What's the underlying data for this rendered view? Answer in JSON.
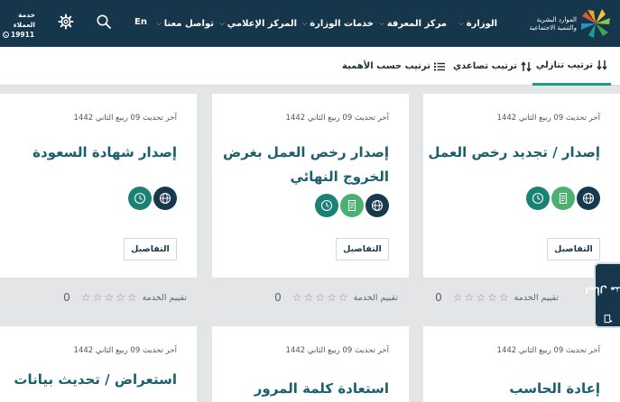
{
  "header": {
    "logo_text": [
      "الموارد البشرية",
      "والتنمية الاجتماعية"
    ],
    "nav": [
      {
        "label": "الوزارة",
        "has_menu": true
      },
      {
        "label": "مركز المعرفة",
        "has_menu": true
      },
      {
        "label": "خدمات الوزارة",
        "has_menu": true
      },
      {
        "label": "المركز الإعلامي",
        "has_menu": true
      },
      {
        "label": "تواصل معنا",
        "has_menu": true
      }
    ],
    "language": "En",
    "customer_care": {
      "line1": "خدمة",
      "line2": "العملاء",
      "phone": "19911"
    },
    "colors": {
      "header_bg": "#16364c",
      "accent": "#1b9d8a"
    }
  },
  "sort_options": [
    {
      "label": "ترتيب تنازلي",
      "icon": "sort-descending-icon",
      "active": true
    },
    {
      "label": "ترتيب تصاعدي",
      "icon": "sort-ascending-icon",
      "active": false
    },
    {
      "label": "ترتيب حسب الأهمية",
      "icon": "list-icon",
      "active": false
    }
  ],
  "cards": [
    {
      "date": "آخر تحديث 09 ربيع الثاني 1442",
      "title": [
        "إصدار / تجديد رخص العمل"
      ],
      "icons": [
        "globe-icon",
        "document-icon",
        "clock-icon"
      ],
      "details": "التفاصيل"
    },
    {
      "date": "آخر تحديث 09 ربيع الثاني 1442",
      "title": [
        "إصدار رخص العمل بغرض",
        "الخروج النهائي"
      ],
      "icons": [
        "globe-icon",
        "document-icon",
        "clock-icon"
      ],
      "details": "التفاصيل"
    },
    {
      "date": "آخر تحديث 09 ربيع الثاني 1442",
      "title": [
        "إصدار شهادة السعودة"
      ],
      "icons": [
        "globe-icon",
        "clock-icon"
      ],
      "details": "التفاصيل"
    },
    {
      "date": "آخر تحديث 09 ربيع الثاني 1442",
      "title": [
        "إعادة الحاسب"
      ]
    },
    {
      "date": "آخر تحديث 09 ربيع الثاني 1442",
      "title": [
        "استعادة كلمة المرور"
      ]
    },
    {
      "date": "آخر تحديث 09 ربيع الثاني 1442",
      "title": [
        "استعراض / تحديث بيانات"
      ]
    }
  ],
  "ratings": [
    {
      "label": "تقييم الخدمة",
      "score": "0",
      "stars": 5
    },
    {
      "label": "تقييم الخدمة",
      "score": "0",
      "stars": 5
    },
    {
      "label": "تقييم الخدمة",
      "score": "0",
      "stars": 5
    }
  ],
  "side_tab": {
    "label": "اسأل مثال"
  }
}
